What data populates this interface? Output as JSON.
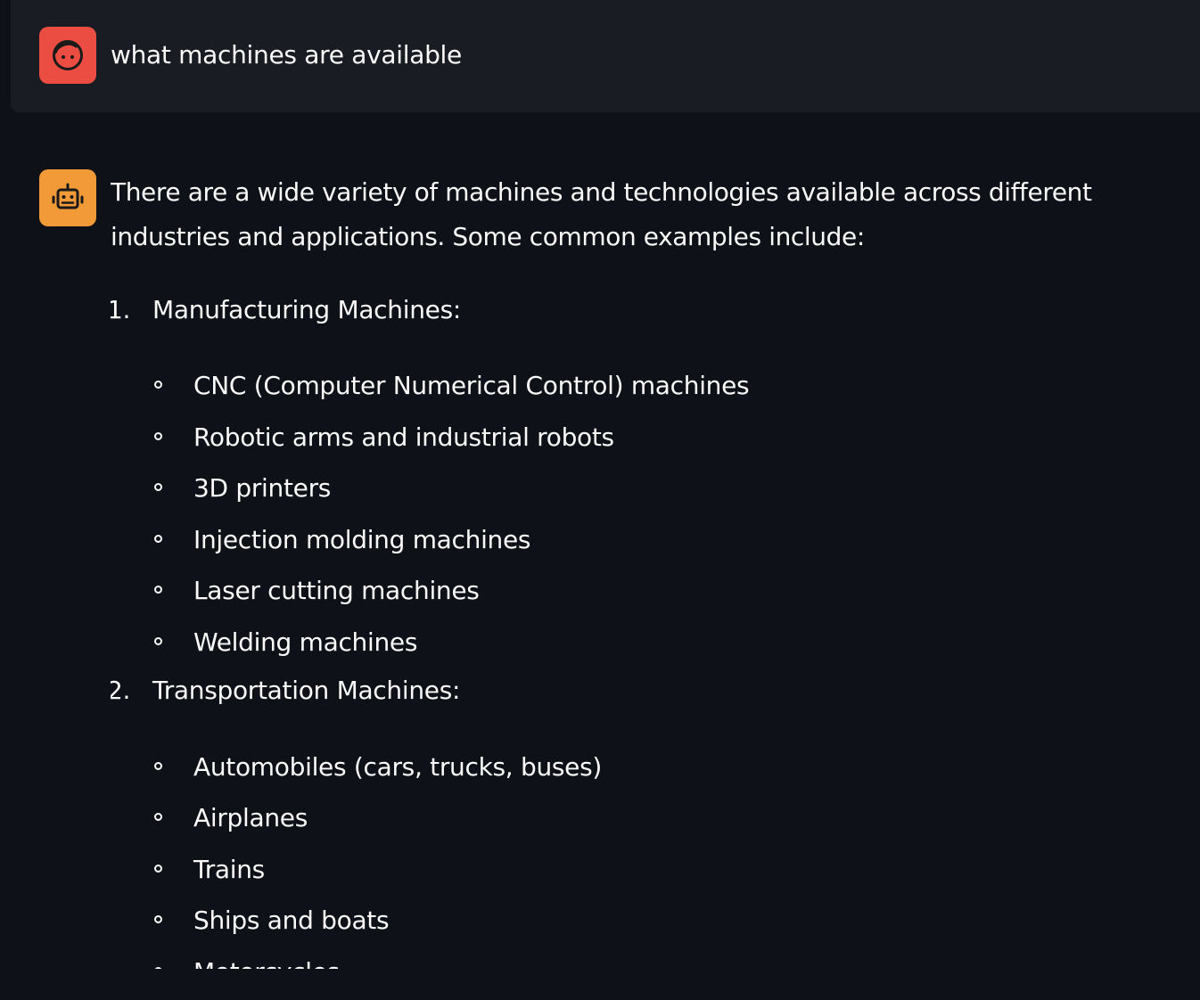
{
  "user_message": {
    "avatar_icon": "user-face-icon",
    "avatar_color": "#ec4d42",
    "text": "what machines are available"
  },
  "assistant_message": {
    "avatar_icon": "robot-icon",
    "avatar_color": "#f29a37",
    "intro": "There are a wide variety of machines and technologies available across different industries and applications. Some common examples include:",
    "categories": [
      {
        "number": "1.",
        "label": "Manufacturing Machines:",
        "items": [
          "CNC (Computer Numerical Control) machines",
          "Robotic arms and industrial robots",
          "3D printers",
          "Injection molding machines",
          "Laser cutting machines",
          "Welding machines"
        ]
      },
      {
        "number": "2.",
        "label": "Transportation Machines:",
        "items": [
          "Automobiles (cars, trucks, buses)",
          "Airplanes",
          "Trains",
          "Ships and boats",
          "Motorcycles"
        ]
      }
    ]
  },
  "colors": {
    "background": "#0e1117",
    "user_message_background": "#1a1c24",
    "text": "#fafafa"
  }
}
